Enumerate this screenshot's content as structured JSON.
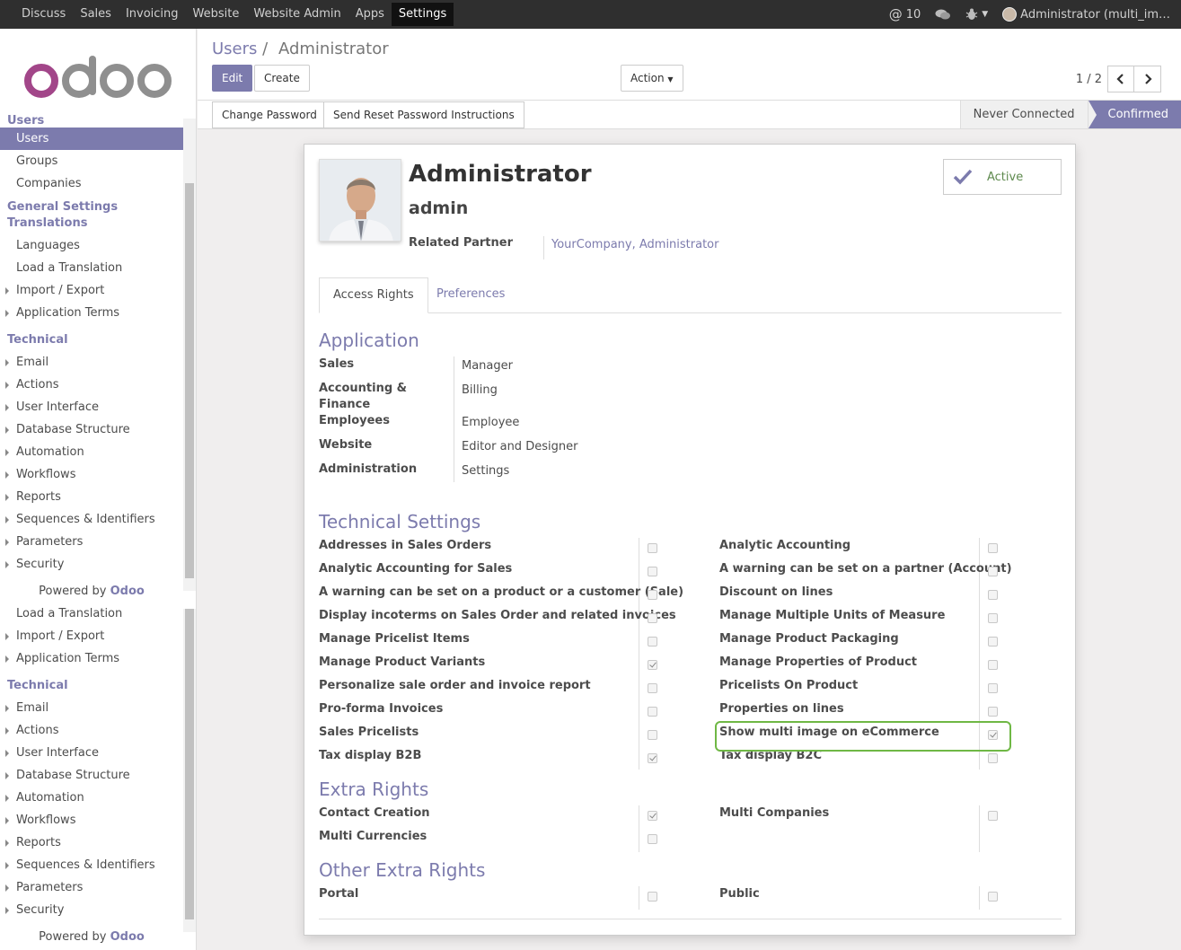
{
  "topbar": {
    "menu": [
      "Discuss",
      "Sales",
      "Invoicing",
      "Website",
      "Website Admin",
      "Apps",
      "Settings"
    ],
    "active_menu": "Settings",
    "mentions_count": "10",
    "user": "Administrator (multi_im…"
  },
  "sidebar": {
    "logo": "odoo",
    "items_a": [
      {
        "label": "Users",
        "type": "head-cut"
      },
      {
        "label": "Users",
        "type": "active"
      },
      {
        "label": "Groups",
        "type": "item"
      },
      {
        "label": "Companies",
        "type": "item"
      },
      {
        "label": "General Settings",
        "type": "head"
      },
      {
        "label": "Translations",
        "type": "head"
      },
      {
        "label": "Languages",
        "type": "item"
      },
      {
        "label": "Load a Translation",
        "type": "item"
      },
      {
        "label": "Import / Export",
        "type": "caret"
      },
      {
        "label": "Application Terms",
        "type": "caret"
      },
      {
        "label": "Technical",
        "type": "head"
      },
      {
        "label": "Email",
        "type": "caret"
      },
      {
        "label": "Actions",
        "type": "caret"
      },
      {
        "label": "User Interface",
        "type": "caret"
      },
      {
        "label": "Database Structure",
        "type": "caret"
      },
      {
        "label": "Automation",
        "type": "caret"
      },
      {
        "label": "Workflows",
        "type": "caret"
      },
      {
        "label": "Reports",
        "type": "caret"
      },
      {
        "label": "Sequences & Identifiers",
        "type": "caret"
      },
      {
        "label": "Parameters",
        "type": "caret"
      },
      {
        "label": "Security",
        "type": "caret"
      }
    ],
    "powered_prefix": "Powered by ",
    "powered_brand": "Odoo",
    "items_b": [
      {
        "label": "Load a Translation",
        "type": "item"
      },
      {
        "label": "Import / Export",
        "type": "caret"
      },
      {
        "label": "Application Terms",
        "type": "caret"
      },
      {
        "label": "Technical",
        "type": "head"
      },
      {
        "label": "Email",
        "type": "caret"
      },
      {
        "label": "Actions",
        "type": "caret"
      },
      {
        "label": "User Interface",
        "type": "caret"
      },
      {
        "label": "Database Structure",
        "type": "caret"
      },
      {
        "label": "Automation",
        "type": "caret"
      },
      {
        "label": "Workflows",
        "type": "caret"
      },
      {
        "label": "Reports",
        "type": "caret"
      },
      {
        "label": "Sequences & Identifiers",
        "type": "caret"
      },
      {
        "label": "Parameters",
        "type": "caret"
      },
      {
        "label": "Security",
        "type": "caret"
      }
    ]
  },
  "control_panel": {
    "breadcrumb_parent": "Users",
    "breadcrumb_sep": "/",
    "breadcrumb_current": "Administrator",
    "edit_label": "Edit",
    "create_label": "Create",
    "action_label": "Action",
    "pager_value": "1 / 2"
  },
  "statusbar": {
    "change_password": "Change Password",
    "reset_password": "Send Reset Password Instructions",
    "states": [
      "Never Connected",
      "Confirmed"
    ],
    "current_state": "Confirmed"
  },
  "form": {
    "name": "Administrator",
    "login": "admin",
    "related_partner_label": "Related Partner",
    "related_partner_value": "YourCompany, Administrator",
    "active_label": "Active",
    "tabs": [
      "Access Rights",
      "Preferences"
    ],
    "application": {
      "title": "Application",
      "rows": [
        {
          "label": "Sales",
          "value": "Manager"
        },
        {
          "label": "Accounting & Finance",
          "value": "Billing"
        },
        {
          "label": "Employees",
          "value": "Employee"
        },
        {
          "label": "Website",
          "value": "Editor and Designer"
        },
        {
          "label": "Administration",
          "value": "Settings"
        }
      ]
    },
    "technical_settings": {
      "title": "Technical Settings",
      "left": [
        {
          "label": "Addresses in Sales Orders",
          "checked": false
        },
        {
          "label": "Analytic Accounting for Sales",
          "checked": false
        },
        {
          "label": "A warning can be set on a product or a customer (Sale)",
          "checked": false
        },
        {
          "label": "Display incoterms on Sales Order and related invoices",
          "checked": false
        },
        {
          "label": "Manage Pricelist Items",
          "checked": false
        },
        {
          "label": "Manage Product Variants",
          "checked": true
        },
        {
          "label": "Personalize sale order and invoice report",
          "checked": false
        },
        {
          "label": "Pro-forma Invoices",
          "checked": false
        },
        {
          "label": "Sales Pricelists",
          "checked": false
        },
        {
          "label": "Tax display B2B",
          "checked": true
        }
      ],
      "right": [
        {
          "label": "Analytic Accounting",
          "checked": false
        },
        {
          "label": "A warning can be set on a partner (Account)",
          "checked": false
        },
        {
          "label": "Discount on lines",
          "checked": false
        },
        {
          "label": "Manage Multiple Units of Measure",
          "checked": false
        },
        {
          "label": "Manage Product Packaging",
          "checked": false
        },
        {
          "label": "Manage Properties of Product",
          "checked": false
        },
        {
          "label": "Pricelists On Product",
          "checked": false
        },
        {
          "label": "Properties on lines",
          "checked": false
        },
        {
          "label": "Show multi image on eCommerce",
          "checked": true
        },
        {
          "label": "Tax display B2C",
          "checked": false
        }
      ]
    },
    "extra_rights": {
      "title": "Extra Rights",
      "left": [
        {
          "label": "Contact Creation",
          "checked": true
        },
        {
          "label": "Multi Currencies",
          "checked": false
        }
      ],
      "right": [
        {
          "label": "Multi Companies",
          "checked": false
        }
      ]
    },
    "other_extra_rights": {
      "title": "Other Extra Rights",
      "left": [
        {
          "label": "Portal",
          "checked": false
        }
      ],
      "right": [
        {
          "label": "Public",
          "checked": false
        }
      ]
    }
  },
  "colors": {
    "brand": "#7c7bad",
    "topbar": "#2f2f2f",
    "highlight": "#6fb845",
    "active_check": "#5e8a4e"
  }
}
